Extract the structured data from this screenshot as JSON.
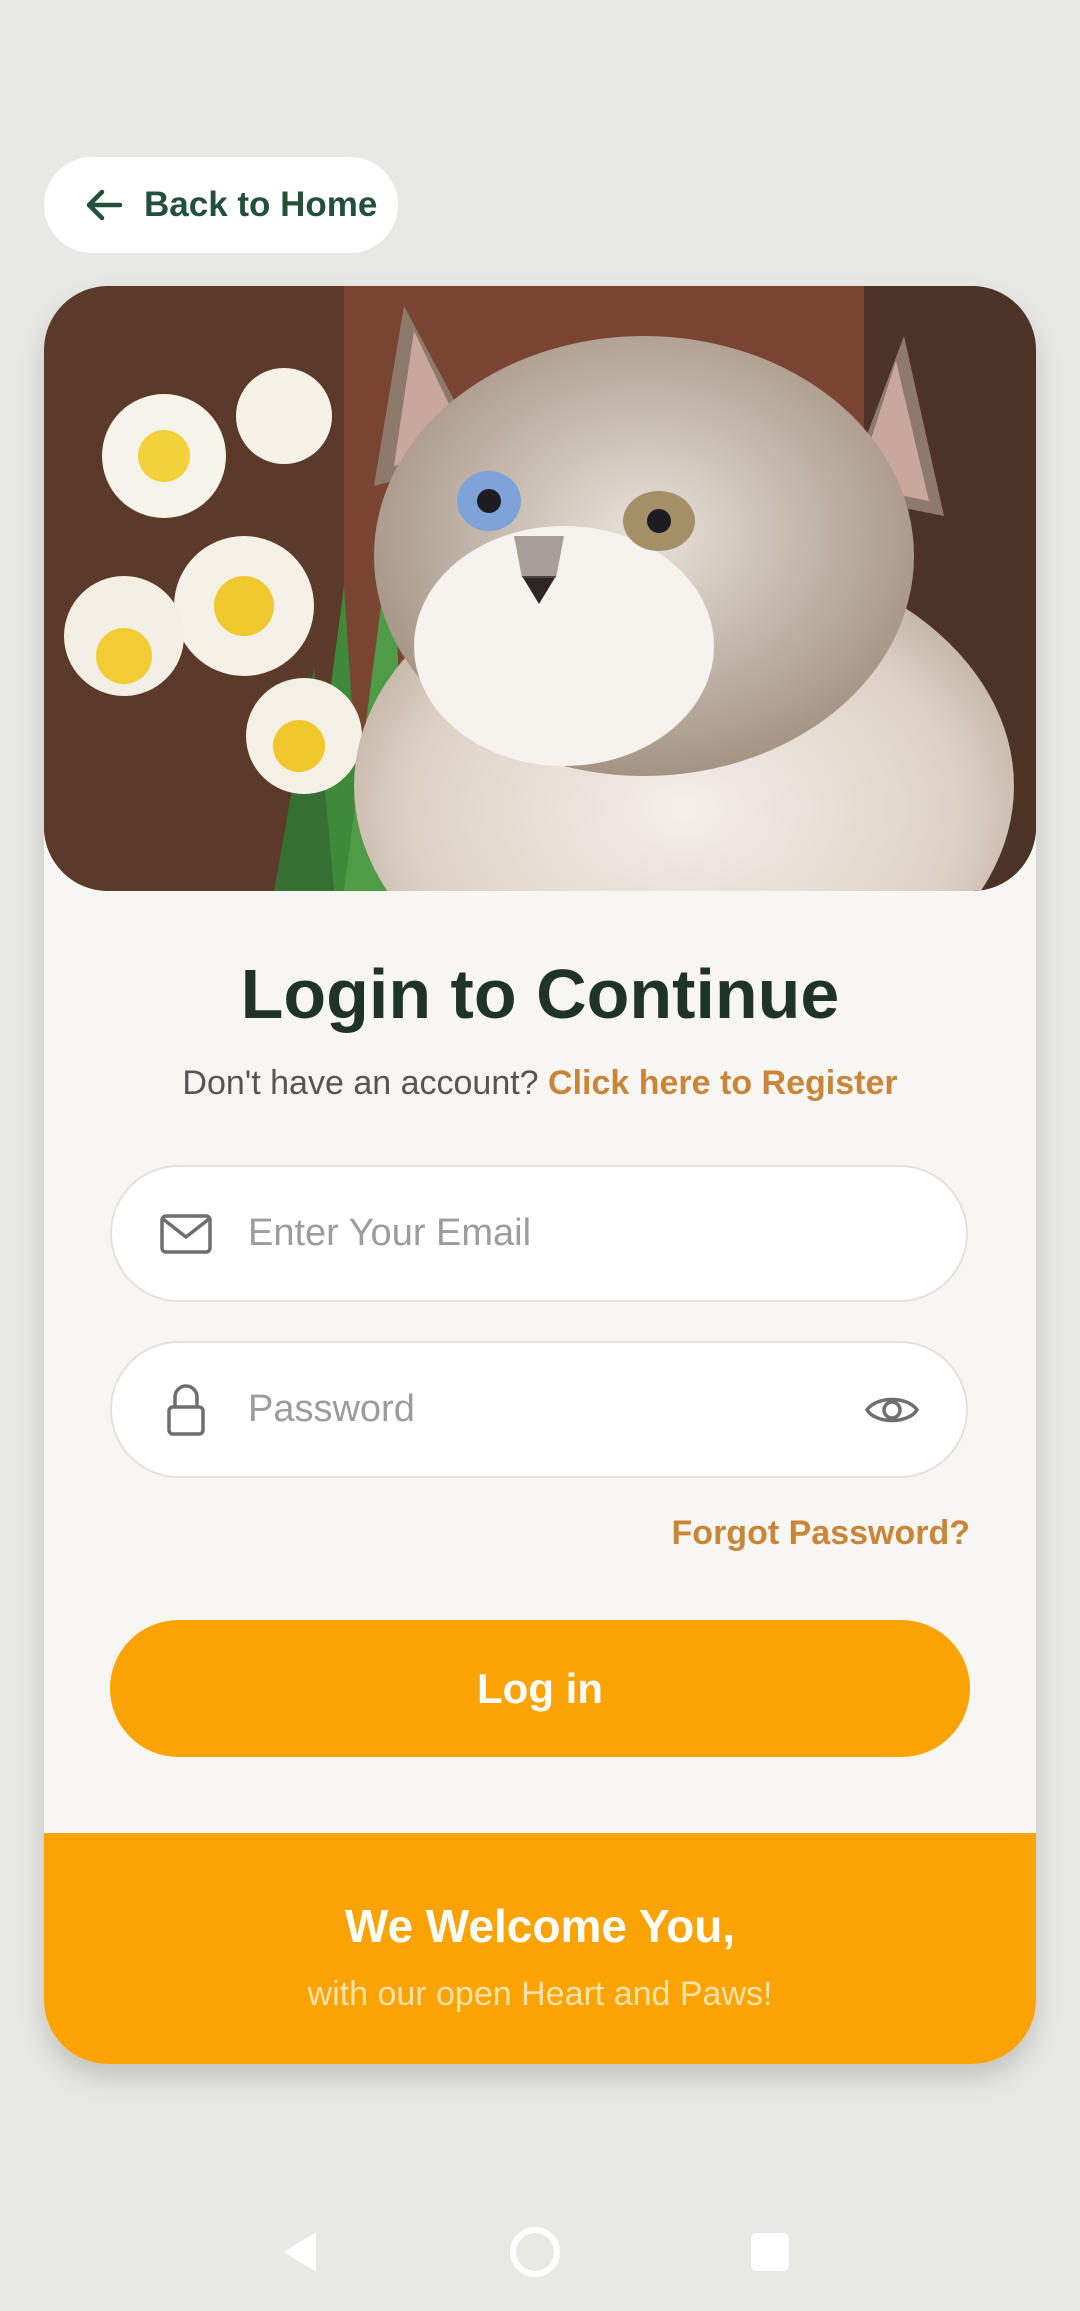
{
  "back": {
    "label": "Back to Home",
    "icon": "arrow-left-icon"
  },
  "hero": {
    "image": "cat-with-daffodils-photo"
  },
  "login": {
    "title": "Login to Continue",
    "register_prompt": "Don't have an account?",
    "register_link": "Click here to Register",
    "email_placeholder": "Enter Your Email",
    "email_value": "",
    "password_placeholder": "Password",
    "password_value": "",
    "forgot": "Forgot Password?",
    "submit": "Log in"
  },
  "footer": {
    "title": "We Welcome You,",
    "subtitle": "with our open Heart and Paws!"
  },
  "colors": {
    "accent": "#fba302",
    "link": "#c98538",
    "heading": "#1f3326",
    "back_label": "#23503a",
    "background": "#e8e8e4"
  },
  "nav": {
    "back": "nav-back-icon",
    "home": "nav-home-icon",
    "recents": "nav-recents-icon"
  }
}
